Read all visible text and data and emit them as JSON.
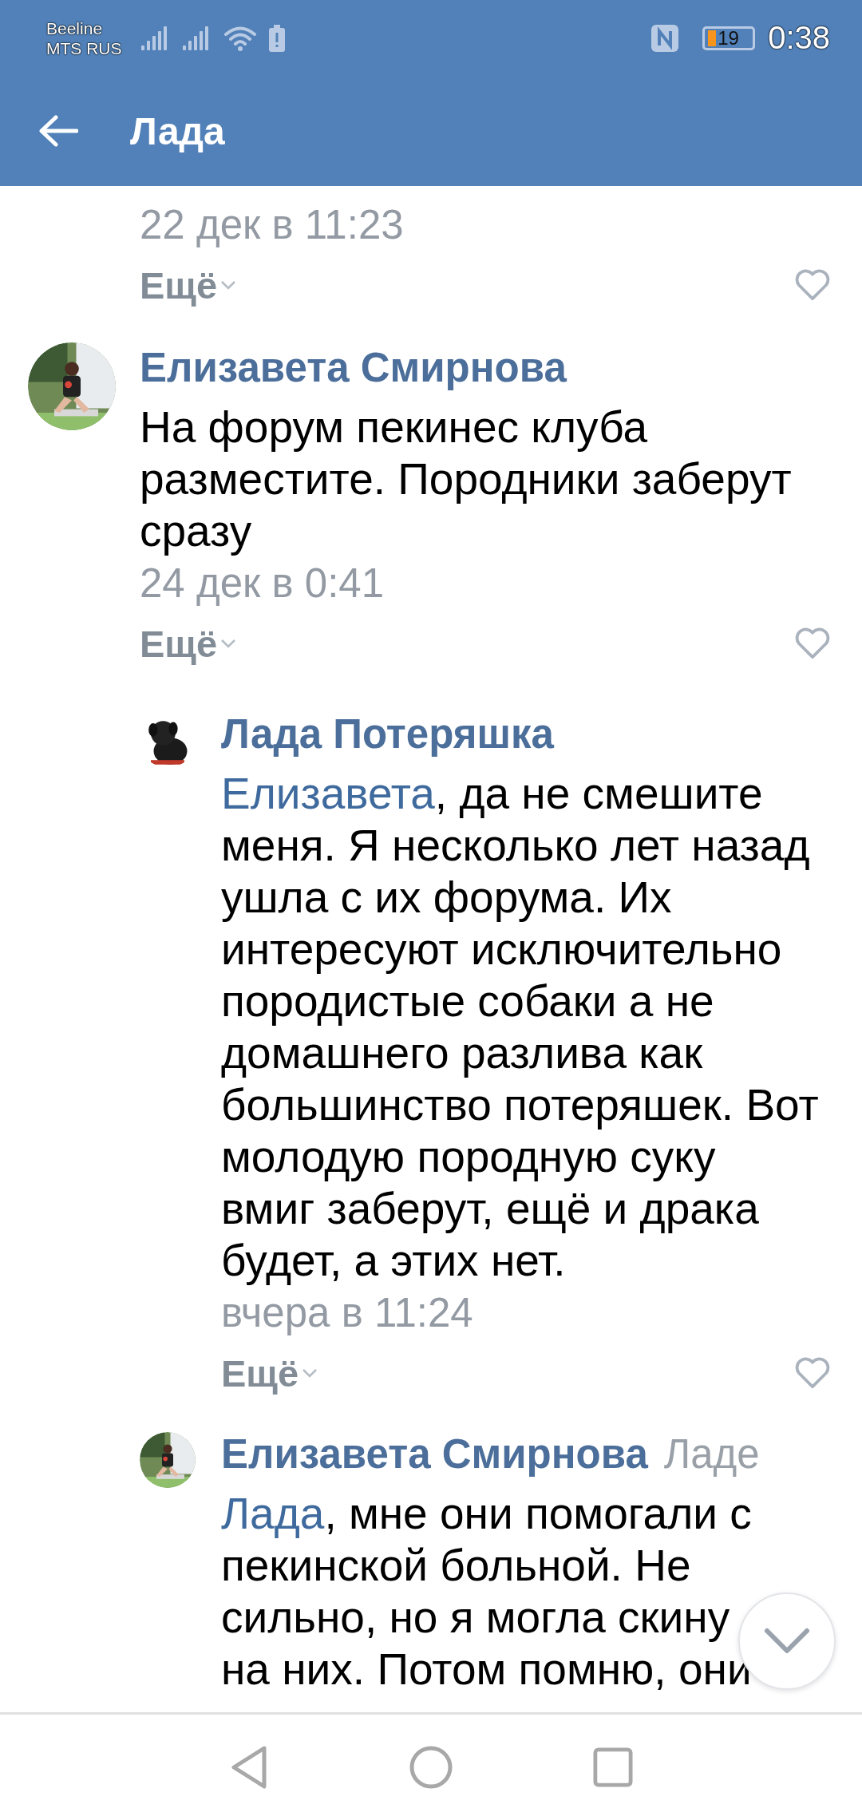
{
  "status_bar": {
    "carriers": [
      "Beeline",
      "MTS RUS"
    ],
    "battery": "19",
    "time": "0:38"
  },
  "header": {
    "title": "Лада"
  },
  "comments": [
    {
      "kind": "tail",
      "date": "22 дек в 11:23",
      "more": "Ещё",
      "liked": false
    },
    {
      "kind": "comment",
      "author": "Елизавета Смирнова",
      "lines": [
        "На форум пекинес клуба",
        "разместите. Породники заберут",
        "сразу"
      ],
      "date": "24 дек в 0:41",
      "more": "Ещё",
      "liked": false
    },
    {
      "kind": "reply",
      "author": "Лада Потеряшка",
      "mention": "Елизавета",
      "lines": [
        ", да не смешите",
        "меня. Я несколько лет назад",
        "ушла с их форума. Их",
        "интересуют исключительно",
        "породистые собаки а не",
        "домашнего разлива как",
        "большинство потеряшек. Вот",
        "молодую породную суку",
        "вмиг заберут, ещё и драка",
        "будет, а этих нет."
      ],
      "date": "вчера в 11:24",
      "more": "Ещё",
      "liked": false
    },
    {
      "kind": "reply",
      "author": "Елизавета Смирнова",
      "addressee": "Ладе",
      "mention": "Лада",
      "lines": [
        ", мне они помогали с",
        "пекинской больной. Не",
        "сильно, но я могла скину",
        "на них. Потом помню, они"
      ]
    }
  ]
}
